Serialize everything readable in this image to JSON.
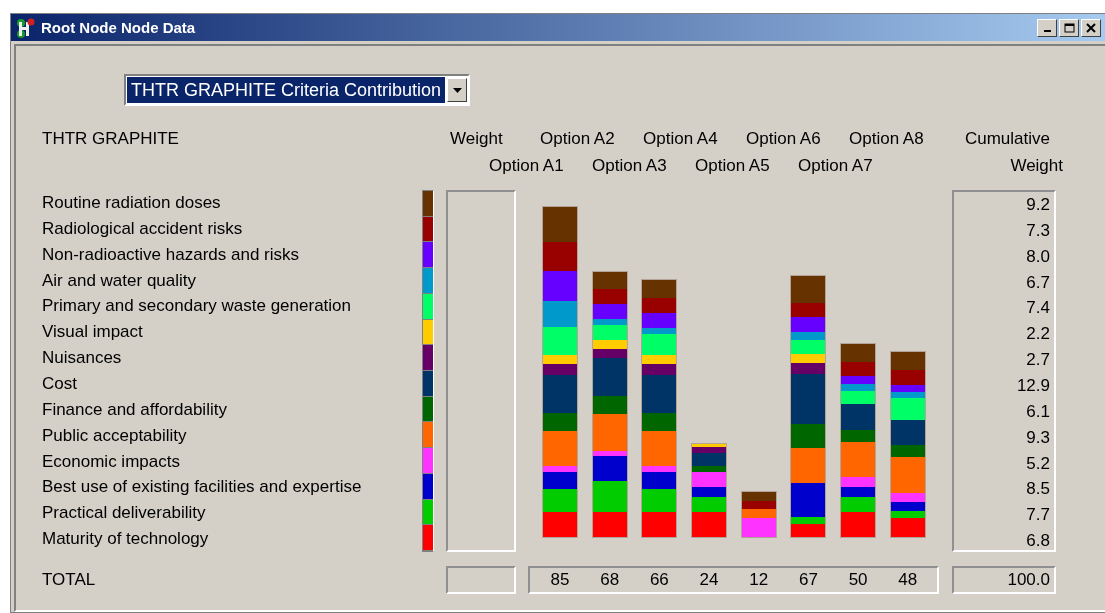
{
  "window": {
    "title": "Root Node Node Data"
  },
  "dropdown": {
    "value": "THTR GRAPHITE Criteria Contribution"
  },
  "header": {
    "title": "THTR GRAPHITE",
    "weight": "Weight",
    "cumulative": [
      "Cumulative",
      "Weight"
    ],
    "options": [
      "Option A1",
      "Option A2",
      "Option A3",
      "Option A4",
      "Option A5",
      "Option A6",
      "Option A7",
      "Option A8"
    ]
  },
  "criteria": [
    {
      "name": "Routine radiation doses",
      "color": "#663300",
      "cumulative": "9.2"
    },
    {
      "name": "Radiological accident risks",
      "color": "#990000",
      "cumulative": "7.3"
    },
    {
      "name": "Non-radioactive hazards and risks",
      "color": "#6600ff",
      "cumulative": "8.0"
    },
    {
      "name": "Air and water quality",
      "color": "#0099cc",
      "cumulative": "6.7"
    },
    {
      "name": "Primary and secondary waste generation",
      "color": "#00ff66",
      "cumulative": "7.4"
    },
    {
      "name": "Visual impact",
      "color": "#ffcc00",
      "cumulative": "2.2"
    },
    {
      "name": "Nuisances",
      "color": "#660066",
      "cumulative": "2.7"
    },
    {
      "name": "Cost",
      "color": "#003366",
      "cumulative": "12.9"
    },
    {
      "name": "Finance and affordability",
      "color": "#006600",
      "cumulative": "6.1"
    },
    {
      "name": "Public acceptability",
      "color": "#ff6600",
      "cumulative": "9.3"
    },
    {
      "name": "Economic impacts",
      "color": "#ff33ff",
      "cumulative": "5.2"
    },
    {
      "name": "Best use of existing facilities and expertise",
      "color": "#0000cc",
      "cumulative": "8.5"
    },
    {
      "name": "Practical deliverability",
      "color": "#00cc00",
      "cumulative": "7.7"
    },
    {
      "name": "Maturity of technology",
      "color": "#ff0000",
      "cumulative": "6.8"
    }
  ],
  "total": {
    "label": "TOTAL",
    "options": [
      "85",
      "68",
      "66",
      "24",
      "12",
      "67",
      "50",
      "48"
    ],
    "cumulative": "100.0"
  }
}
